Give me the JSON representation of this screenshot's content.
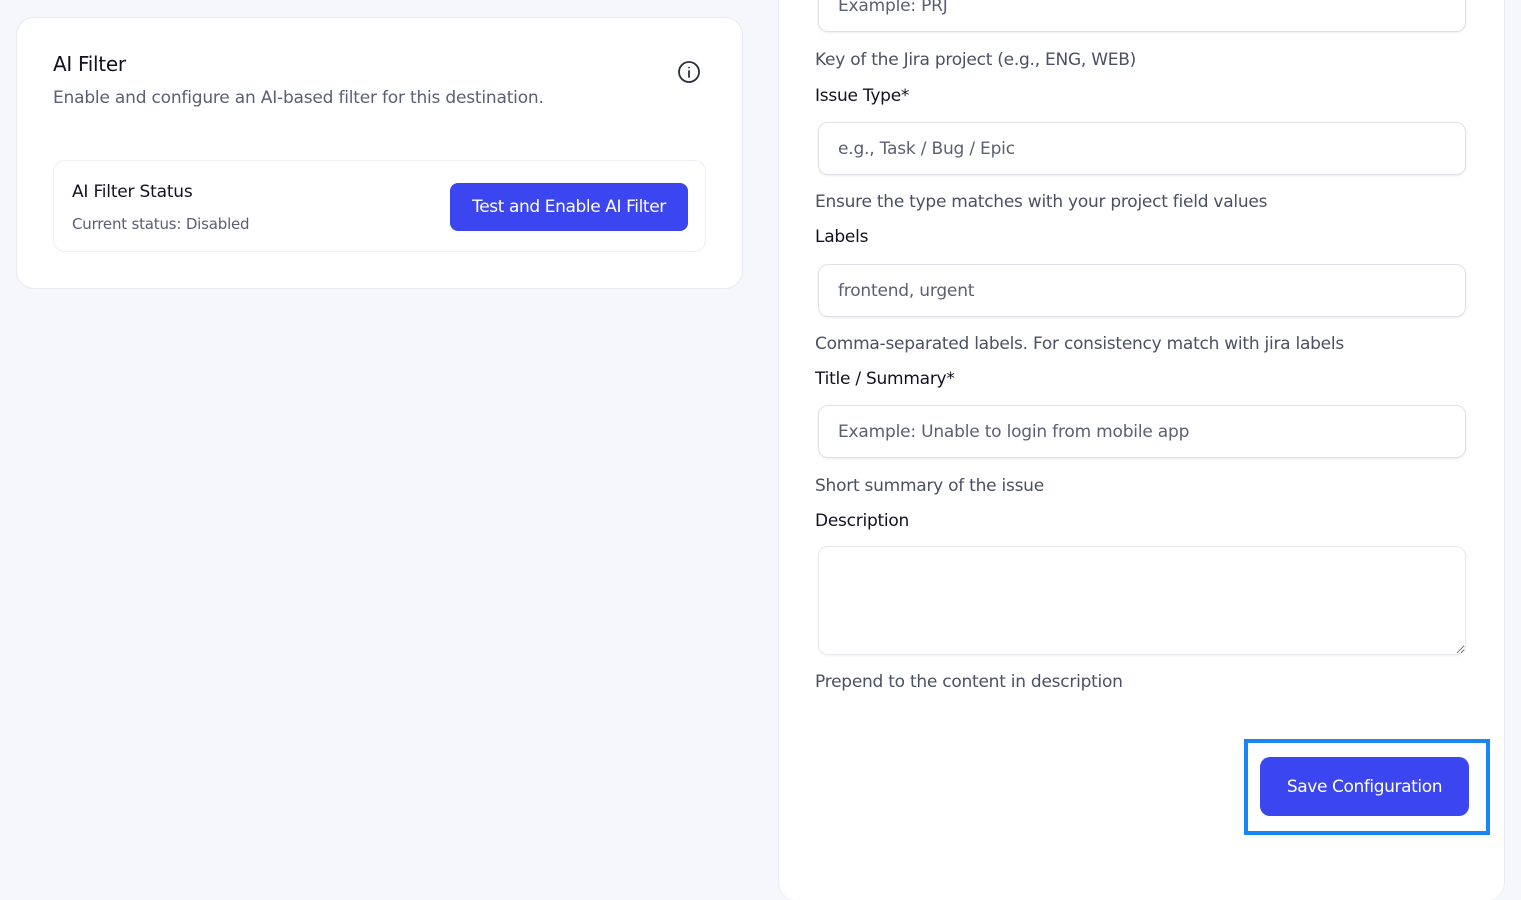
{
  "ai_filter": {
    "title": "AI Filter",
    "subtitle": "Enable and configure an AI-based filter for this destination.",
    "info_icon": "info-circle-icon",
    "status": {
      "title": "AI Filter Status",
      "current": "Current status: Disabled",
      "button_label": "Test and Enable AI Filter"
    }
  },
  "form": {
    "project_key": {
      "placeholder": "Example: PRJ",
      "help": "Key of the Jira project (e.g., ENG, WEB)"
    },
    "issue_type": {
      "label": "Issue Type*",
      "placeholder": "e.g., Task / Bug / Epic",
      "help": "Ensure the type matches with your project field values"
    },
    "labels": {
      "label": "Labels",
      "placeholder": "frontend, urgent",
      "help": "Comma-separated labels. For consistency match with jira labels"
    },
    "title_summary": {
      "label": "Title / Summary*",
      "placeholder": "Example: Unable to login from mobile app",
      "help": "Short summary of the issue"
    },
    "description": {
      "label": "Description",
      "value": "",
      "help": "Prepend to the content in description"
    },
    "save_label": "Save Configuration"
  },
  "colors": {
    "accent": "#3b46f1",
    "highlight": "#1687f5",
    "background": "#f6f6fd"
  }
}
